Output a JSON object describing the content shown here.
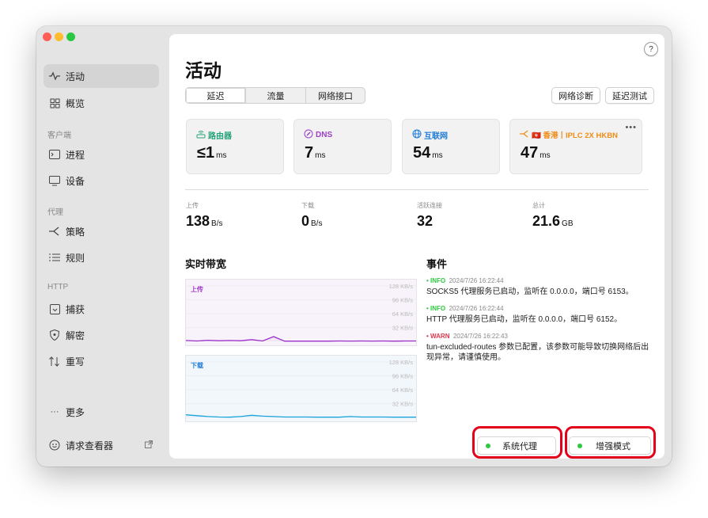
{
  "sidebar": {
    "items": [
      {
        "label": "活动",
        "icon": "activity-icon"
      },
      {
        "label": "概览",
        "icon": "grid-icon"
      },
      {
        "label": "进程",
        "icon": "terminal-icon"
      },
      {
        "label": "设备",
        "icon": "monitor-icon"
      },
      {
        "label": "策略",
        "icon": "branch-icon"
      },
      {
        "label": "规则",
        "icon": "list-icon"
      },
      {
        "label": "捕获",
        "icon": "capture-icon"
      },
      {
        "label": "解密",
        "icon": "shield-icon"
      },
      {
        "label": "重写",
        "icon": "rewrite-icon"
      },
      {
        "label": "更多",
        "icon": "ellipsis-icon"
      },
      {
        "label": "请求查看器",
        "icon": "viewer-icon"
      }
    ],
    "sections": [
      "客户端",
      "代理",
      "HTTP"
    ]
  },
  "main": {
    "title": "活动",
    "tabs": [
      "延迟",
      "流量",
      "网络接口"
    ],
    "active_tab": "延迟",
    "actions": [
      "网络诊断",
      "延迟测试"
    ],
    "help": "?"
  },
  "latency_cards": [
    {
      "label": "路由器",
      "value": "≤1",
      "unit": "ms",
      "color": "#27a37b",
      "icon": "router-icon"
    },
    {
      "label": "DNS",
      "value": "7",
      "unit": "ms",
      "color": "#9b3fc7",
      "icon": "compass-icon"
    },
    {
      "label": "互联网",
      "value": "54",
      "unit": "ms",
      "color": "#1f7bd8",
      "icon": "globe-icon"
    },
    {
      "label": "🇭🇰 香港丨IPLC 2X HKBN",
      "value": "47",
      "unit": "ms",
      "color": "#f08c16",
      "icon": "branch-icon",
      "more": "•••"
    }
  ],
  "stats": [
    {
      "label": "上传",
      "value": "138",
      "unit": "B/s"
    },
    {
      "label": "下载",
      "value": "0",
      "unit": "B/s"
    },
    {
      "label": "活跃连接",
      "value": "32",
      "unit": ""
    },
    {
      "label": "总计",
      "value": "21.6",
      "unit": "GB"
    }
  ],
  "bandwidth": {
    "title": "实时带宽",
    "upload_label": "上传",
    "download_label": "下载",
    "ticks": [
      "128 KB/s",
      "96 KB/s",
      "64 KB/s",
      "32 KB/s"
    ]
  },
  "events": {
    "title": "事件",
    "items": [
      {
        "level": "INFO",
        "time": "2024/7/26 16:22:44",
        "message": "SOCKS5 代理服务已启动，监听在 0.0.0.0，端口号 6153。",
        "color": "#2ec940"
      },
      {
        "level": "INFO",
        "time": "2024/7/26 16:22:44",
        "message": "HTTP 代理服务已启动，监听在 0.0.0.0，端口号 6152。",
        "color": "#2ec940"
      },
      {
        "level": "WARN",
        "time": "2024/7/26 16:22:43",
        "message": "tun-excluded-routes 参数已配置，该参数可能导致切换网络后出现异常，请谨慎使用。",
        "color": "#e0364b"
      }
    ]
  },
  "bottom": {
    "system_proxy": "系统代理",
    "enhanced_mode": "增强模式"
  },
  "chart_data": [
    {
      "type": "line",
      "series": [
        {
          "name": "上传",
          "values": [
            2,
            1,
            2.5,
            1.5,
            2,
            1.5,
            4,
            1,
            11,
            0.5,
            0.5,
            0.5,
            0.5,
            0.5,
            1,
            0.8,
            1,
            0.7,
            1,
            0.5,
            1,
            1
          ]
        }
      ],
      "ylim": [
        0,
        128
      ],
      "color": "#9b30c8"
    },
    {
      "type": "line",
      "series": [
        {
          "name": "下载",
          "values": [
            6,
            4,
            2,
            1,
            0.5,
            2,
            5,
            3,
            2,
            1,
            1,
            1,
            0.5,
            0.5,
            0.5,
            2,
            1,
            1,
            1,
            0.5,
            0.5,
            0.5
          ]
        }
      ],
      "ylim": [
        0,
        128
      ],
      "color": "#1aa3d8"
    }
  ]
}
